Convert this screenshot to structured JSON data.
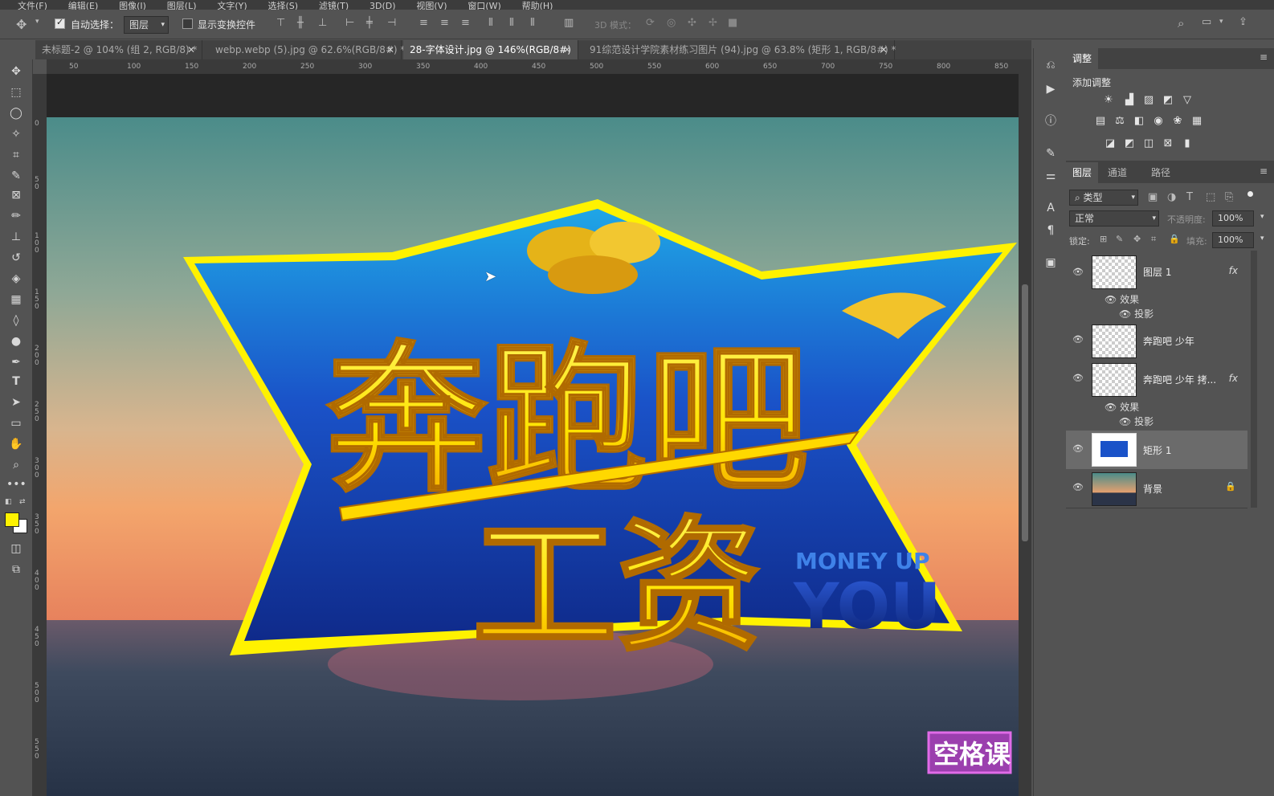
{
  "menubar": {
    "items": [
      "文件(F)",
      "编辑(E)",
      "图像(I)",
      "图层(L)",
      "文字(Y)",
      "选择(S)",
      "滤镜(T)",
      "3D(D)",
      "视图(V)",
      "窗口(W)",
      "帮助(H)"
    ]
  },
  "options": {
    "auto_select_label": "自动选择：",
    "auto_select_value": "图层",
    "show_transform_label": "显示变换控件",
    "mode_3d_label": "3D 模式："
  },
  "tabs": [
    {
      "label": "未标题-2 @ 104% (组 2, RGB/8) *"
    },
    {
      "label": "webp.webp (5).jpg @ 62.6%(RGB/8#) *"
    },
    {
      "label": "28-字体设计.jpg @ 146%(RGB/8#)"
    },
    {
      "label": "91综范设计学院素材练习图片 (94).jpg @ 63.8% (矩形 1, RGB/8#) *"
    }
  ],
  "ruler_top": [
    "50",
    "100",
    "150",
    "200",
    "250",
    "300",
    "350",
    "400",
    "450",
    "500",
    "550",
    "600",
    "650",
    "700",
    "750",
    "800",
    "850"
  ],
  "ruler_left": [
    "0",
    "50",
    "100",
    "150",
    "200",
    "250",
    "300",
    "350",
    "400",
    "450",
    "500",
    "550"
  ],
  "artwork": {
    "title_line1": "奔跑吧",
    "title_line2": "工资",
    "tag_line1": "MONEY UP",
    "tag_line2": "YOU",
    "watermark": "空格课"
  },
  "adjustments": {
    "tab": "调整",
    "subtitle": "添加调整"
  },
  "layers_panel": {
    "tabs": [
      "图层",
      "通道",
      "路径"
    ],
    "filter_value": "类型",
    "blend_mode": "正常",
    "opacity_label": "不透明度:",
    "opacity_value": "100%",
    "lock_label": "锁定:",
    "fill_label": "填充:",
    "fill_value": "100%",
    "layers": [
      {
        "name": "图层 1",
        "fx": "fx",
        "effects_label": "效果",
        "effect": "投影"
      },
      {
        "name": "奔跑吧 少年"
      },
      {
        "name": "奔跑吧 少年 拷...",
        "fx": "fx",
        "effects_label": "效果",
        "effect": "投影"
      },
      {
        "name": "矩形 1"
      },
      {
        "name": "背景"
      }
    ]
  },
  "colors": {
    "foreground": "#fff200",
    "background": "#ffffff",
    "star_blue": "#1a52c8",
    "title_yellow": "#ffe400"
  }
}
